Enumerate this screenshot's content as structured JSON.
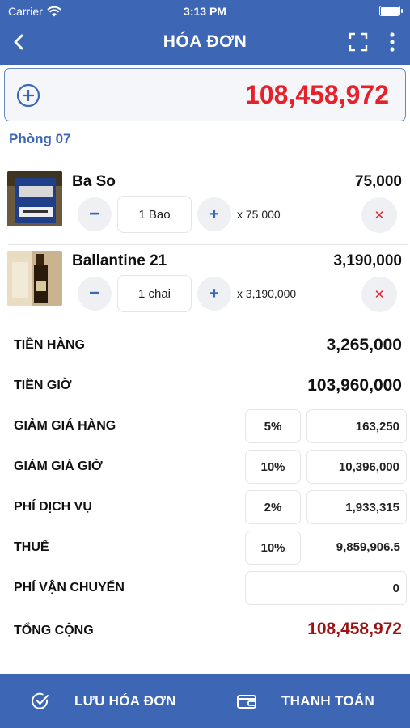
{
  "status_bar": {
    "carrier": "Carrier",
    "time": "3:13 PM"
  },
  "nav": {
    "title": "HÓA ĐƠN"
  },
  "total": {
    "amount": "108,458,972"
  },
  "room": "Phòng 07",
  "items": [
    {
      "name": "Ba So",
      "price": "75,000",
      "quantity": "1 Bao",
      "unit_price": "x 75,000"
    },
    {
      "name": "Ballantine 21",
      "price": "3,190,000",
      "quantity": "1 chai",
      "unit_price": "x 3,190,000"
    }
  ],
  "summary": {
    "goods": {
      "label": "TIỀN HÀNG",
      "value": "3,265,000"
    },
    "hours": {
      "label": "TIỀN GIỜ",
      "value": "103,960,000"
    },
    "goods_discount": {
      "label": "GIẢM GIÁ HÀNG",
      "percent": "5%",
      "value": "163,250"
    },
    "hours_discount": {
      "label": "GIẢM GIÁ GIỜ",
      "percent": "10%",
      "value": "10,396,000"
    },
    "service_fee": {
      "label": "PHÍ DỊCH VỤ",
      "percent": "2%",
      "value": "1,933,315"
    },
    "tax": {
      "label": "THUẾ",
      "percent": "10%",
      "value": "9,859,906.5"
    },
    "shipping": {
      "label": "PHÍ VẬN CHUYỂN",
      "value": "0"
    },
    "grand_total": {
      "label": "TỔNG CỘNG",
      "value": "108,458,972"
    }
  },
  "bottom_bar": {
    "save_label": "LƯU HÓA ĐƠN",
    "pay_label": "THANH TOÁN"
  },
  "colors": {
    "primary": "#3d67b5",
    "total_red": "#e8202a",
    "grand_total": "#9b1414"
  }
}
